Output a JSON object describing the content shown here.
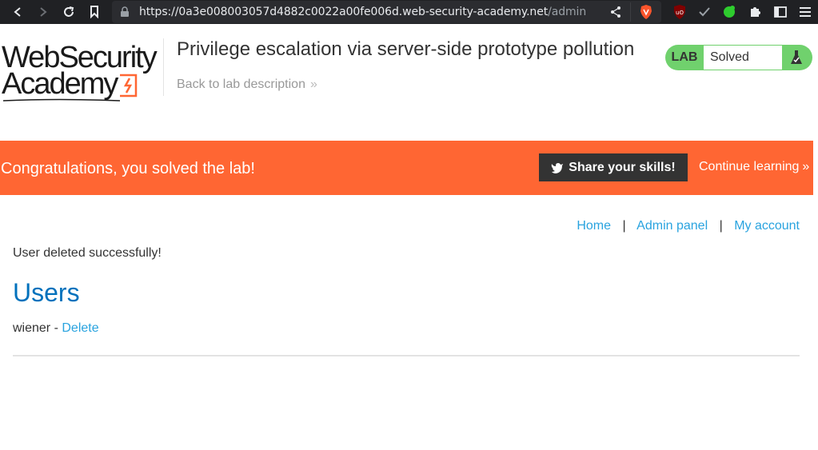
{
  "browser": {
    "url_main": "https://0a3e008003057d4882c0022a00fe006d.web-security-academy.net",
    "url_path": "/admin",
    "icons": [
      "back-icon",
      "forward-icon",
      "reload-icon",
      "bookmark-icon",
      "lock-icon",
      "share-icon",
      "brave-shield-icon",
      "ublock-icon",
      "check-icon",
      "green-extension-icon",
      "puzzle-icon",
      "sidebar-icon",
      "menu-icon"
    ]
  },
  "header": {
    "logo_line1": "WebSecurity",
    "logo_line2": "Academy",
    "lab_title": "Privilege escalation via server-side prototype pollution",
    "back_link": "Back to lab description",
    "lab_tag": "LAB",
    "lab_status": "Solved",
    "status_color": "#70d16d"
  },
  "banner": {
    "text": "Congratulations, you solved the lab!",
    "share_label": "Share your skills!",
    "continue_label": "Continue learning",
    "color": "#ff6633"
  },
  "nav": {
    "home": "Home",
    "admin": "Admin panel",
    "account": "My account",
    "separator": "|"
  },
  "main": {
    "message": "User deleted successfully!",
    "heading": "Users",
    "users": [
      {
        "name": "wiener",
        "separator": " - ",
        "action": "Delete"
      }
    ]
  }
}
